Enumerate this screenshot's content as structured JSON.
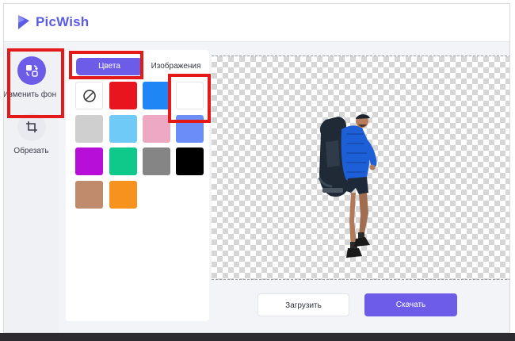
{
  "app": {
    "name": "PicWish",
    "brand_color": "#5b5ce6",
    "accent": "#6c5ce7"
  },
  "sidebar": {
    "tools": [
      {
        "label": "Изменить фон",
        "icon": "change-background-icon",
        "active": true
      },
      {
        "label": "Обрезать",
        "icon": "crop-icon",
        "active": false
      }
    ]
  },
  "panel": {
    "tabs": [
      {
        "label": "Цвета",
        "active": true
      },
      {
        "label": "Изображения",
        "active": false
      }
    ],
    "swatches": [
      {
        "name": "none",
        "color": "transparent",
        "icon": "no-color-icon"
      },
      {
        "name": "red",
        "color": "#e8141e"
      },
      {
        "name": "blue",
        "color": "#1e87f5"
      },
      {
        "name": "white",
        "color": "#ffffff"
      },
      {
        "name": "light-gray",
        "color": "#cfcfcf"
      },
      {
        "name": "light-blue",
        "color": "#6fcaf7"
      },
      {
        "name": "pink",
        "color": "#eda8c3"
      },
      {
        "name": "periwinkle",
        "color": "#6b8df7"
      },
      {
        "name": "purple",
        "color": "#b80fd8"
      },
      {
        "name": "green",
        "color": "#0fc98a"
      },
      {
        "name": "gray",
        "color": "#858585"
      },
      {
        "name": "black",
        "color": "#000000"
      },
      {
        "name": "tan",
        "color": "#c08a6c"
      },
      {
        "name": "orange",
        "color": "#f7921f"
      }
    ]
  },
  "canvas": {
    "subject": "hiker-with-backpack"
  },
  "actions": {
    "upload_label": "Загрузить",
    "download_label": "Скачать"
  }
}
